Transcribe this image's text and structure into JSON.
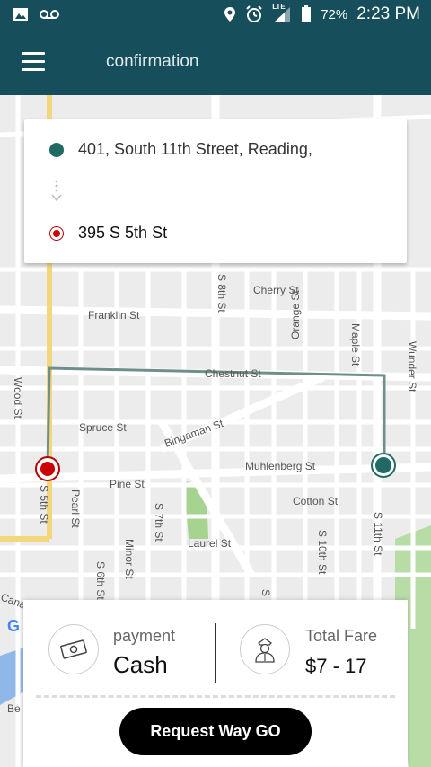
{
  "status_bar": {
    "time": "2:23 PM",
    "battery_percent": "72%",
    "network": "LTE",
    "left_icons": [
      "image-icon",
      "voicemail-icon"
    ],
    "right_icons": [
      "location-icon",
      "alarm-icon",
      "signal-icon",
      "battery-icon"
    ]
  },
  "app_bar": {
    "title": "confirmation",
    "menu_icon": "hamburger-menu-icon",
    "color": "#174e5c"
  },
  "map": {
    "streets": [
      "Cherry St",
      "Franklin St",
      "Chestnut St",
      "Spruce St",
      "Bingaman St",
      "Muhlenberg St",
      "Pine St",
      "Cotton St",
      "Laurel St",
      "S 8th St",
      "Orange St",
      "Maple St",
      "Wunder St",
      "Wood St",
      "S 5th St",
      "Pearl St",
      "S 7th St",
      "Minor St",
      "S 6th St",
      "S 10th St",
      "S 11th St",
      "Cana",
      "Be",
      "S"
    ],
    "route_color": "#6f8f8a",
    "origin_color": "#1f6b64",
    "destination_color": "#c00000"
  },
  "route": {
    "origin": "401, South 11th Street, Reading,",
    "destination": "395 S 5th St"
  },
  "booking": {
    "payment_label": "payment",
    "payment_value": "Cash",
    "fare_label": "Total Fare",
    "fare_value": "$7 - 17",
    "request_button": "Request Way GO"
  },
  "google_logo": "G"
}
